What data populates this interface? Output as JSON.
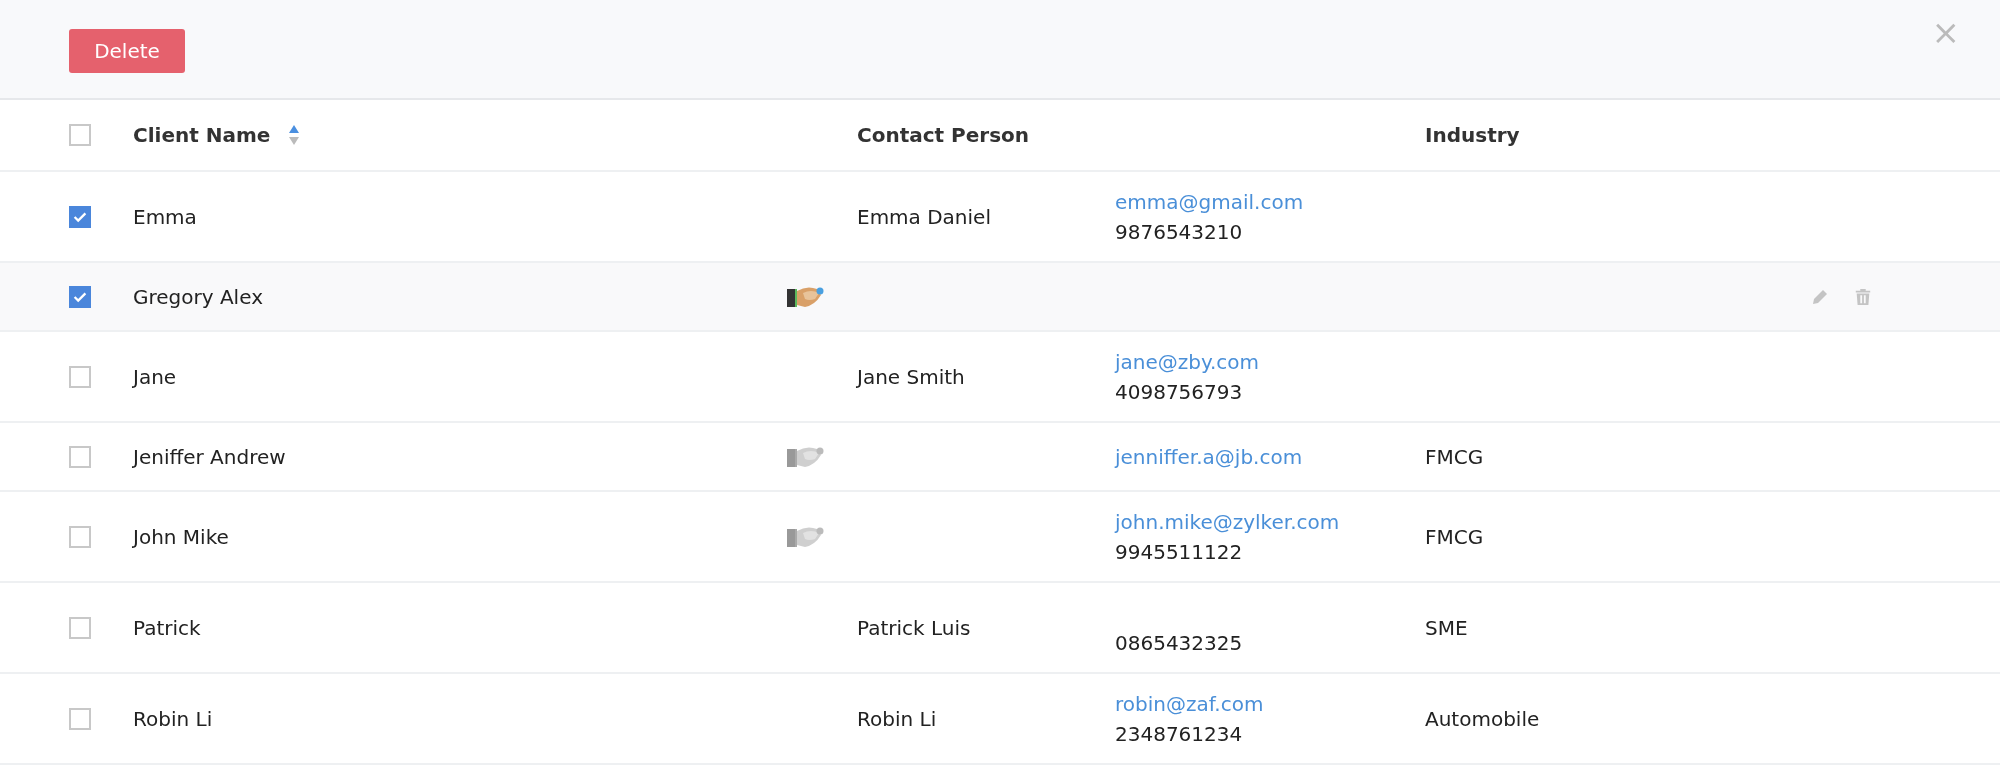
{
  "toolbar": {
    "delete_button": "Delete",
    "close": "×"
  },
  "table": {
    "all_checked": false,
    "columns": [
      {
        "label": "Client Name",
        "sorted_ascending": true
      },
      {
        "label": "Contact Person"
      },
      {
        "label": "Industry"
      }
    ],
    "rows": [
      {
        "name": "Emma",
        "checked": true,
        "hovered": false,
        "contact": "Emma Daniel",
        "email": "emma@gmail.com",
        "phone": "9876543210"
      },
      {
        "name": "Gregory Alex",
        "checked": true,
        "hovered": true,
        "handshake": {
          "active": true
        }
      },
      {
        "name": "Jane",
        "checked": false,
        "hovered": false,
        "contact": "Jane Smith",
        "email": "jane@zby.com",
        "phone": "4098756793"
      },
      {
        "name": "Jeniffer Andrew",
        "checked": false,
        "hovered": false,
        "handshake": {
          "active": false
        },
        "email": "jenniffer.a@jb.com",
        "industry": "FMCG"
      },
      {
        "name": "John Mike",
        "checked": false,
        "hovered": false,
        "handshake": {
          "active": false
        },
        "email": "john.mike@zylker.com",
        "phone": "9945511122",
        "industry": "FMCG"
      },
      {
        "name": "Patrick",
        "checked": false,
        "hovered": false,
        "contact": "Patrick Luis",
        "phone": "0865432325",
        "industry": "SME"
      },
      {
        "name": "Robin Li",
        "checked": false,
        "hovered": false,
        "contact": "Robin Li",
        "email": "robin@zaf.com",
        "phone": "2348761234",
        "industry": "Automobile"
      }
    ]
  }
}
